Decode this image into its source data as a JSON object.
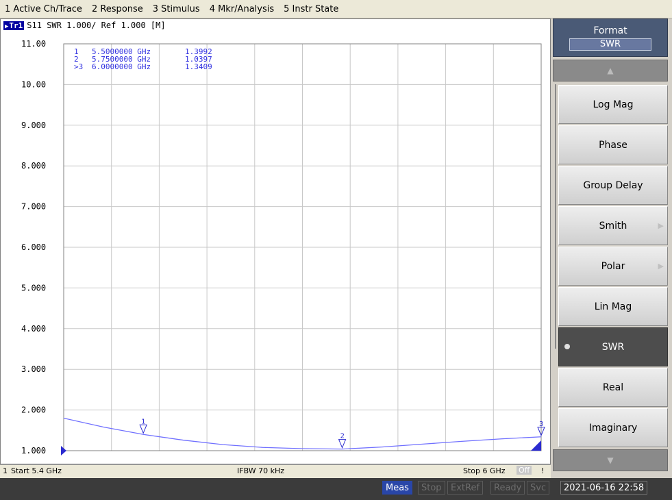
{
  "menu": [
    "1 Active Ch/Trace",
    "2 Response",
    "3 Stimulus",
    "4 Mkr/Analysis",
    "5 Instr State"
  ],
  "trace": {
    "tag": "Tr1",
    "header": "S11  SWR 1.000/ Ref 1.000 [M]",
    "ref_indicator": "1.000"
  },
  "markers": [
    {
      "prefix": "1",
      "freq": "5.5000000 GHz",
      "value": "1.3992"
    },
    {
      "prefix": "2",
      "freq": "5.7500000 GHz",
      "value": "1.0397"
    },
    {
      "prefix": ">3",
      "freq": "6.0000000 GHz",
      "value": "1.3409"
    }
  ],
  "softkeys": {
    "title": "Format",
    "current": "SWR",
    "items": [
      {
        "label": "Log Mag"
      },
      {
        "label": "Phase"
      },
      {
        "label": "Group Delay"
      },
      {
        "label": "Smith",
        "submenu": true
      },
      {
        "label": "Polar",
        "submenu": true
      },
      {
        "label": "Lin Mag"
      },
      {
        "label": "SWR",
        "active": true
      },
      {
        "label": "Real"
      },
      {
        "label": "Imaginary"
      }
    ],
    "up_icon": "triangle-up-icon",
    "down_icon": "triangle-down-icon"
  },
  "status": {
    "channel": "1",
    "start": "Start 5.4 GHz",
    "ifbw": "IFBW 70 kHz",
    "stop": "Stop 6 GHz",
    "off": "Off",
    "excl": "!"
  },
  "bottom": {
    "meas": "Meas",
    "stop": "Stop",
    "extref": "ExtRef",
    "ready": "Ready",
    "svc": "Svc",
    "datetime": "2021-06-16 22:58"
  },
  "chart_data": {
    "type": "line",
    "x_unit": "GHz",
    "xlim": [
      5.4,
      6.0
    ],
    "ylim": [
      1.0,
      11.0
    ],
    "y_ticks": [
      "11.00",
      "10.00",
      "9.000",
      "8.000",
      "7.000",
      "6.000",
      "5.000",
      "4.000",
      "3.000",
      "2.000",
      "1.000"
    ],
    "grid": true,
    "series": [
      {
        "color": "#7070ff",
        "x": [
          5.4,
          5.45,
          5.5,
          5.55,
          5.6,
          5.65,
          5.7,
          5.75,
          5.8,
          5.85,
          5.9,
          5.95,
          6.0
        ],
        "y": [
          1.8,
          1.58,
          1.3992,
          1.26,
          1.15,
          1.08,
          1.05,
          1.0397,
          1.09,
          1.16,
          1.23,
          1.29,
          1.3409
        ]
      }
    ],
    "marker_points": [
      {
        "label": "1",
        "x": 5.5,
        "y": 1.3992
      },
      {
        "label": "2",
        "x": 5.75,
        "y": 1.0397
      },
      {
        "label": "3",
        "x": 6.0,
        "y": 1.3409
      }
    ]
  }
}
